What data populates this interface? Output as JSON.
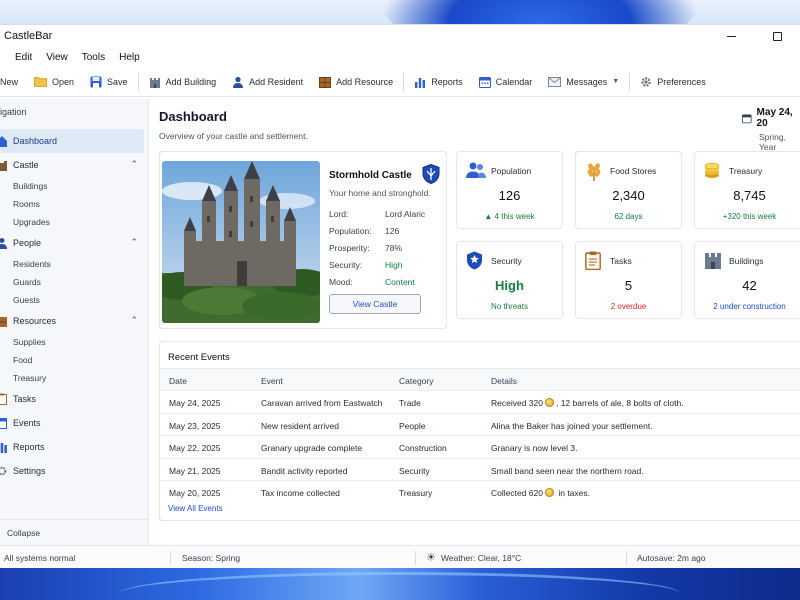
{
  "window": {
    "title": "CastleBar"
  },
  "menu": [
    "Edit",
    "View",
    "Tools",
    "Help"
  ],
  "toolbar": {
    "new": "New",
    "open": "Open",
    "save": "Save",
    "add_building": "Add Building",
    "add_resident": "Add Resident",
    "add_resource": "Add Resource",
    "reports": "Reports",
    "calendar": "Calendar",
    "messages": "Messages",
    "preferences": "Preferences"
  },
  "sidebar": {
    "title": "igation",
    "dashboard": "Dashboard",
    "castle": {
      "label": "Castle",
      "items": [
        "Buildings",
        "Rooms",
        "Upgrades"
      ]
    },
    "people": {
      "label": "People",
      "items": [
        "Residents",
        "Guards",
        "Guests"
      ]
    },
    "resources": {
      "label": "Resources",
      "items": [
        "Supplies",
        "Food",
        "Treasury"
      ]
    },
    "tasks": "Tasks",
    "events": "Events",
    "reports": "Reports",
    "settings": "Settings",
    "collapse": "Collapse"
  },
  "page": {
    "title": "Dashboard",
    "subtitle": "Overview of your castle and settlement.",
    "date": "May 24, 20",
    "season": "Spring, Year"
  },
  "castle": {
    "name": "Stormhold Castle",
    "tagline": "Your home and stronghold.",
    "fields": [
      {
        "key": "Lord:",
        "value": "Lord Alaric"
      },
      {
        "key": "Population:",
        "value": "126"
      },
      {
        "key": "Prosperity:",
        "value": "78%"
      },
      {
        "key": "Security:",
        "value": "High"
      },
      {
        "key": "Mood:",
        "value": "Content"
      }
    ],
    "button": "View Castle"
  },
  "stats": {
    "population": {
      "label": "Population",
      "value": "126",
      "note": "▲ 4 this week",
      "note_color": "#15803d"
    },
    "food": {
      "label": "Food Stores",
      "value": "2,340",
      "note": "62 days",
      "note_color": "#15803d"
    },
    "treasury": {
      "label": "Treasury",
      "value": "8,745",
      "note": "+320 this week",
      "note_color": "#15803d"
    },
    "security": {
      "label": "Security",
      "value": "High",
      "note": "No threats",
      "note_color": "#15803d"
    },
    "tasks": {
      "label": "Tasks",
      "value": "5",
      "note": "2 overdue",
      "note_color": "#dc2626"
    },
    "buildings": {
      "label": "Buildings",
      "value": "42",
      "note": "2 under construction",
      "note_color": "#1d4ed8"
    }
  },
  "events": {
    "title": "Recent Events",
    "headers": [
      "Date",
      "Event",
      "Category",
      "Details"
    ],
    "rows": [
      {
        "date": "May 24, 2025",
        "event": "Caravan arrived from Eastwatch",
        "category": "Trade",
        "details_a": "Received 320",
        "details_b": ", 12 barrels of ale, 8 bolts of cloth.",
        "coin": true
      },
      {
        "date": "May 23, 2025",
        "event": "New resident arrived",
        "category": "People",
        "details_a": "Alina the Baker has joined your settlement.",
        "details_b": "",
        "coin": false
      },
      {
        "date": "May 22, 2025",
        "event": "Granary upgrade complete",
        "category": "Construction",
        "details_a": "Granary is now level 3.",
        "details_b": "",
        "coin": false
      },
      {
        "date": "May 21, 2025",
        "event": "Bandit activity reported",
        "category": "Security",
        "details_a": "Small band seen near the northern road.",
        "details_b": "",
        "coin": false
      },
      {
        "date": "May 20, 2025",
        "event": "Tax income collected",
        "category": "Treasury",
        "details_a": "Collected 620",
        "details_b": " in taxes.",
        "coin": true
      }
    ],
    "view_all": "View All Events"
  },
  "status": {
    "system": "All systems normal",
    "season": "Season: Spring",
    "weather": "Weather: Clear, 18°C",
    "autosave": "Autosave: 2m ago"
  },
  "colors": {
    "accent": "#1d4ed8",
    "good": "#15803d",
    "bad": "#dc2626",
    "active_nav": "#dfe8f5"
  }
}
